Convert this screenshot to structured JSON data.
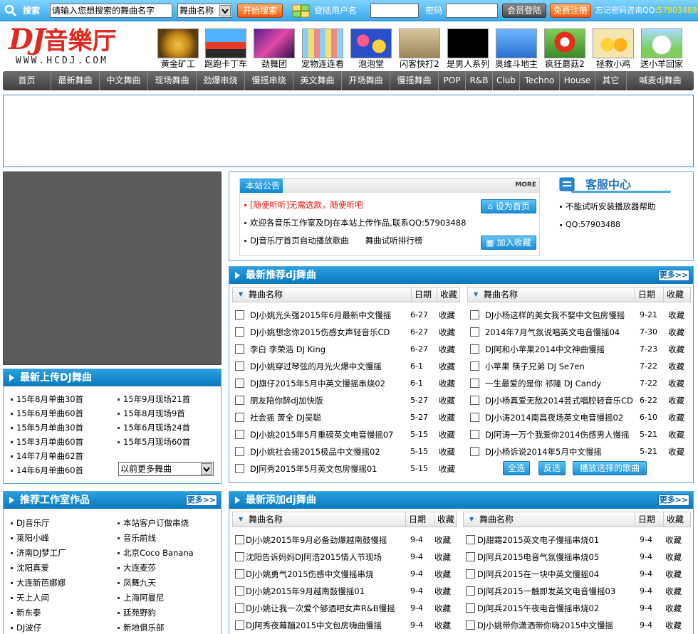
{
  "topbar": {
    "search_label": "搜索",
    "search_placeholder": "请输入您想搜索的舞曲名字",
    "search_select": "舞曲名称",
    "search_button": "开始搜索",
    "login_label": "登陆用户名",
    "password_label": "密码",
    "login_button": "会员登陆",
    "register_button": "免费注册",
    "forgot_text": "忘记密码咨询QQ:",
    "forgot_qq": "57903488"
  },
  "logo": {
    "dj": "DJ",
    "cn": "音樂厅",
    "url": "WWW.HCDJ.COM"
  },
  "games": [
    {
      "label": "黄金矿工",
      "icon": "gold-miner-icon"
    },
    {
      "label": "跑跑卡丁车",
      "icon": "kart-icon"
    },
    {
      "label": "劲舞团",
      "icon": "dance-icon"
    },
    {
      "label": "宠物连连看",
      "icon": "pet-icon"
    },
    {
      "label": "泡泡堂",
      "icon": "bubble-icon"
    },
    {
      "label": "闪客快打2",
      "icon": "fighter-icon"
    },
    {
      "label": "是男人系列",
      "icon": "man-icon"
    },
    {
      "label": "奥维斗地主",
      "icon": "cards-icon"
    },
    {
      "label": "疯狂蘑菇2",
      "icon": "mushroom-icon"
    },
    {
      "label": "拯救小鸡",
      "icon": "chick-icon"
    },
    {
      "label": "送小羊回家",
      "icon": "sheep-icon"
    }
  ],
  "nav": [
    "首页",
    "最新舞曲",
    "中文舞曲",
    "现场舞曲",
    "劲爆串烧",
    "慢摇串烧",
    "英文舞曲",
    "开场舞曲",
    "慢摇舞曲",
    "POP",
    "R&B",
    "Club",
    "Techno",
    "House",
    "其它",
    "喊麦dj舞曲"
  ],
  "notice": {
    "title": "本站公告",
    "more": "MORE",
    "items": [
      "[随便听听]无需选款，随便听吧",
      "欢迎各音乐工作室及DJ在本站上传作品,联系QQ:57903488",
      "DJ音乐厅首页自动播放歌曲　　舞曲试听排行榜"
    ],
    "set_home": "设为首页",
    "add_fav": "加入收藏",
    "service_title": "客服中心",
    "service_items": [
      "不能试听安装播放器帮助",
      "QQ:57903488"
    ]
  },
  "upload": {
    "title": "最新上传DJ舞曲",
    "left": [
      "15年8月单曲30首",
      "15年6月单曲60首",
      "15年5月单曲30首",
      "15年3月单曲60首",
      "14年7月单曲62首",
      "14年6月单曲60首"
    ],
    "right": [
      "15年9月现场21首",
      "15年8月现场9首",
      "15年6月现场24首",
      "15年5月现场60首"
    ],
    "select": "以前更多舞曲"
  },
  "studio": {
    "title": "推荐工作室作品",
    "more": "更多>>",
    "left": [
      "DJ音乐厅",
      "莱阳小峰",
      "济南DJ梦工厂",
      "沈阳真爱",
      "大连新芭娜娜",
      "天上人间",
      "新东泰",
      "DJ波仔"
    ],
    "right": [
      "本站客户订做串烧",
      "音乐前线",
      "北京Coco Banana",
      "大连麦莎",
      "凤舞九天",
      "上海阿曼尼",
      "廷苑野豹",
      "新地俱乐部"
    ]
  },
  "recommend": {
    "title": "最新推荐dj舞曲",
    "more": "更多>>",
    "col_name": "舞曲名称",
    "col_date": "日期",
    "col_fav": "收藏",
    "left": [
      {
        "name": "DJ小姚光头强2015年6月最新中文慢摇",
        "date": "6-27"
      },
      {
        "name": "DJ小姚想念你2015伤感女声轻音乐CD",
        "date": "6-27"
      },
      {
        "name": "李白 李荣浩 DJ King",
        "date": "6-27"
      },
      {
        "name": "DJ小姚穿过琴弦的月光火爆中文慢摇",
        "date": "6-1"
      },
      {
        "name": "DJ旗仔2015年5月中英文慢摇串烧02",
        "date": "6-1"
      },
      {
        "name": "朋友陪你醉dj加快版",
        "date": "5-27"
      },
      {
        "name": "社会摇 萧全 DJ吴聪",
        "date": "5-27"
      },
      {
        "name": "DJ小姚2015年5月重磅英文电音慢摇07",
        "date": "5-15"
      },
      {
        "name": "DJ小姚社会摇2015极品中文慢摇02",
        "date": "5-15"
      },
      {
        "name": "DJ阿秀2015年5月英文包房慢摇01",
        "date": "5-15"
      }
    ],
    "right": [
      {
        "name": "DJ小杨这样的美女我不娶中文包房慢摇",
        "date": "9-21"
      },
      {
        "name": "2014年7月气氛说唱英文电音慢摇04",
        "date": "7-30"
      },
      {
        "name": "DJ阿和小苹果2014中文神曲慢摇",
        "date": "7-23"
      },
      {
        "name": "小苹果 筷子兄弟 DJ Se7en",
        "date": "7-22"
      },
      {
        "name": "一生最爱的是你 祁隆 DJ Candy",
        "date": "7-22"
      },
      {
        "name": "DJ小杨真爱无敌2014芸式唱腔轻音乐CD",
        "date": "6-22"
      },
      {
        "name": "DJ小涛2014南昌夜场英文电音慢摇02",
        "date": "6-10"
      },
      {
        "name": "DJ阿涛一万个我爱你2014伤感男人慢摇",
        "date": "5-21"
      },
      {
        "name": "DJ小杨诉说2014年5月中文慢摇",
        "date": "5-21"
      }
    ],
    "fav_label": "收藏",
    "btn_all": "全选",
    "btn_invert": "反选",
    "btn_play": "播放选择的歌曲"
  },
  "newest": {
    "title": "最新添加dj舞曲",
    "more": "更多>>",
    "col_name": "舞曲名称",
    "col_date": "日期",
    "col_fav": "收藏",
    "left": [
      {
        "name": "DJ小姚2015年9月必备劲爆越南鼓慢摇",
        "date": "9-4"
      },
      {
        "name": "沈阳告诉妈妈DJ阿浩2015情人节现场",
        "date": "9-4"
      },
      {
        "name": "DJ小姚勇气2015伤感中文慢摇串烧",
        "date": "9-4"
      },
      {
        "name": "DJ小姚2015年9月越南鼓慢摇01",
        "date": "9-4"
      },
      {
        "name": "DJ小姚让我一次爱个够酒吧女声R&B慢摇",
        "date": "9-4"
      },
      {
        "name": "DJ阿秀夜幕蹦2015中文包房嗨曲慢摇",
        "date": "9-4"
      }
    ],
    "right": [
      {
        "name": "DJ甜霜2015英文电子慢摇串烧01",
        "date": "9-4"
      },
      {
        "name": "DJ阿兵2015电音气氛慢摇串烧05",
        "date": "9-4"
      },
      {
        "name": "DJ阿兵2015在一块中英文慢摇04",
        "date": "9-4"
      },
      {
        "name": "DJ阿兵2015一触即发英文电音慢摇03",
        "date": "9-4"
      },
      {
        "name": "DJ阿兵2015午夜电音慢摇串烧02",
        "date": "9-4"
      },
      {
        "name": "DJ小姚带你潇洒带你嗨2015中文慢摇",
        "date": "9-4"
      }
    ],
    "fav_label": "收藏"
  }
}
